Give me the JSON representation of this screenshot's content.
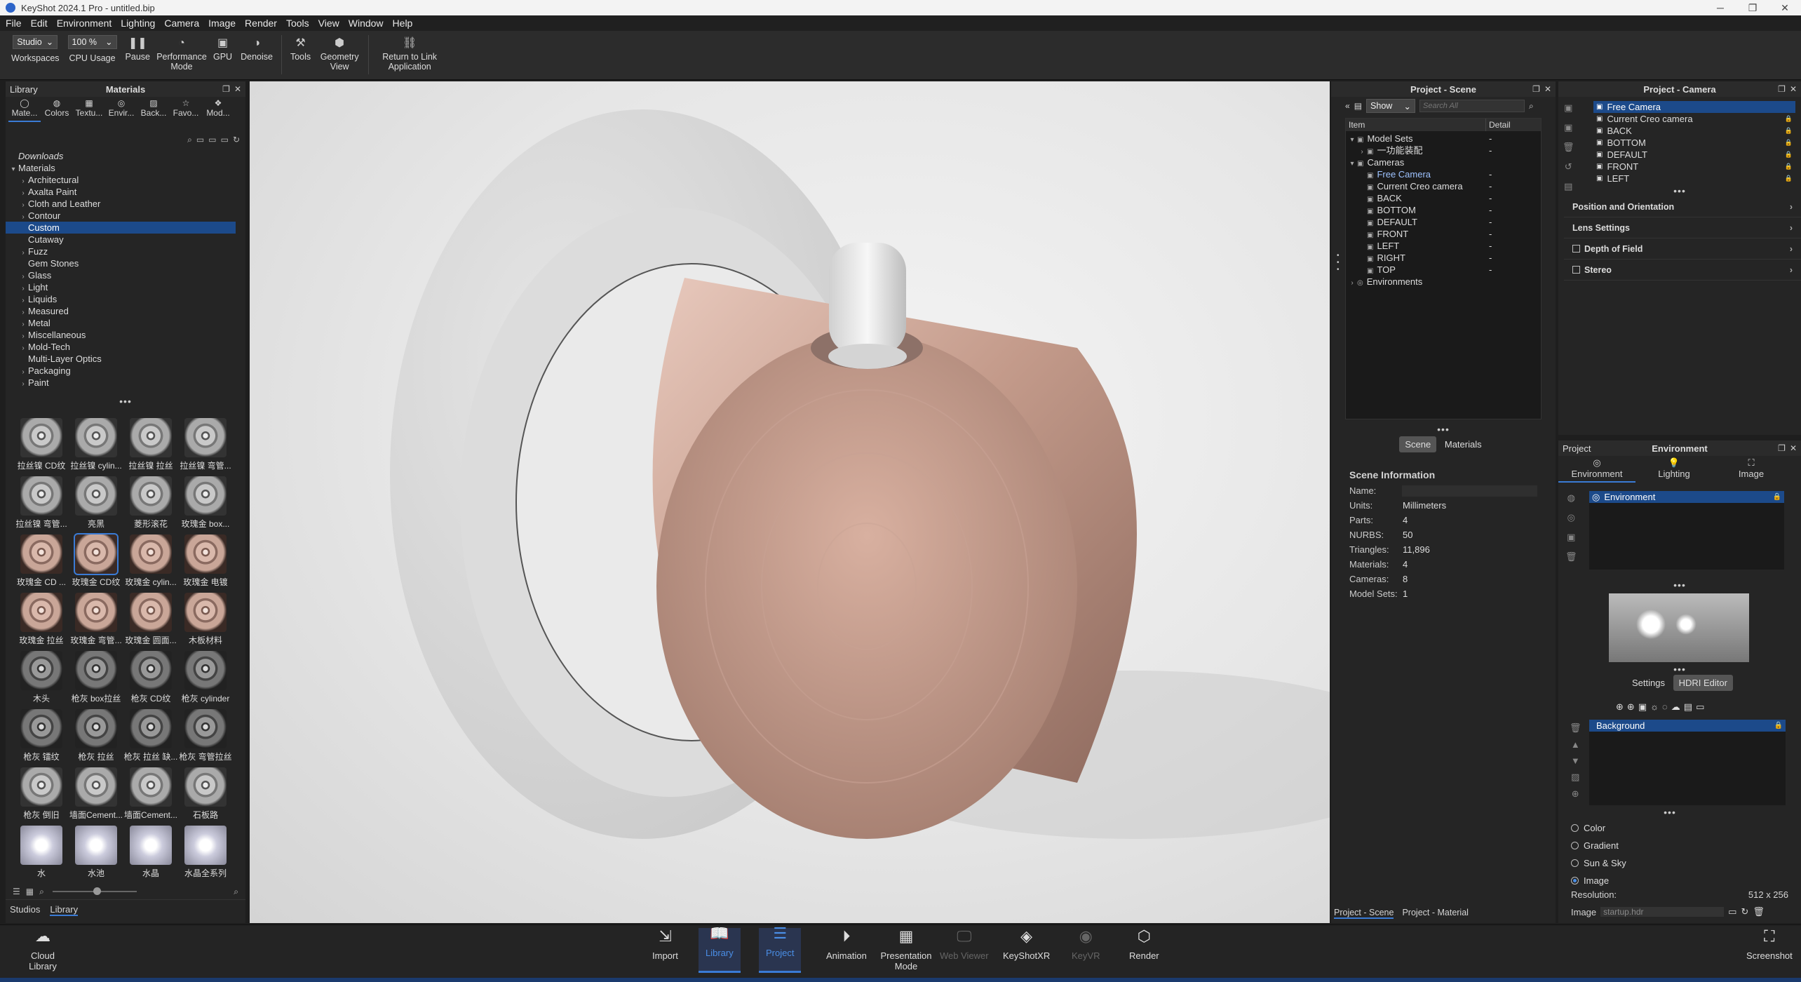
{
  "window": {
    "title": "KeyShot 2024.1 Pro - untitled.bip"
  },
  "menu": [
    "File",
    "Edit",
    "Environment",
    "Lighting",
    "Camera",
    "Image",
    "Render",
    "Tools",
    "View",
    "Window",
    "Help"
  ],
  "toolbar": {
    "workspace_select": "Studio",
    "workspaces_label": "Workspaces",
    "cpu_select": "100 %",
    "cpu_label": "CPU Usage",
    "pause_label": "Pause",
    "perf_label": "Performance Mode",
    "gpu_label": "GPU",
    "denoise_label": "Denoise",
    "tools_label": "Tools",
    "geometry_label": "Geometry View",
    "return_label": "Return to Link Application"
  },
  "library": {
    "panel_title": "Library",
    "header": "Materials",
    "tabs": [
      "Mate...",
      "Colors",
      "Textu...",
      "Envir...",
      "Back...",
      "Favo...",
      "Mod..."
    ],
    "tree": [
      {
        "label": "Downloads",
        "italic": true,
        "indent": 0,
        "arrow": ""
      },
      {
        "label": "Materials",
        "indent": 0,
        "arrow": "v"
      },
      {
        "label": "Architectural",
        "indent": 1,
        "arrow": ">"
      },
      {
        "label": "Axalta Paint",
        "indent": 1,
        "arrow": ">"
      },
      {
        "label": "Cloth and Leather",
        "indent": 1,
        "arrow": ">"
      },
      {
        "label": "Contour",
        "indent": 1,
        "arrow": ">"
      },
      {
        "label": "Custom",
        "indent": 1,
        "arrow": "",
        "selected": true
      },
      {
        "label": "Cutaway",
        "indent": 1,
        "arrow": ""
      },
      {
        "label": "Fuzz",
        "indent": 1,
        "arrow": ">"
      },
      {
        "label": "Gem Stones",
        "indent": 1,
        "arrow": ""
      },
      {
        "label": "Glass",
        "indent": 1,
        "arrow": ">"
      },
      {
        "label": "Light",
        "indent": 1,
        "arrow": ">"
      },
      {
        "label": "Liquids",
        "indent": 1,
        "arrow": ">"
      },
      {
        "label": "Measured",
        "indent": 1,
        "arrow": ">"
      },
      {
        "label": "Metal",
        "indent": 1,
        "arrow": ">"
      },
      {
        "label": "Miscellaneous",
        "indent": 1,
        "arrow": ">"
      },
      {
        "label": "Mold-Tech",
        "indent": 1,
        "arrow": ">"
      },
      {
        "label": "Multi-Layer Optics",
        "indent": 1,
        "arrow": ""
      },
      {
        "label": "Packaging",
        "indent": 1,
        "arrow": ">"
      },
      {
        "label": "Paint",
        "indent": 1,
        "arrow": ">"
      }
    ],
    "thumbs": [
      "拉丝镍 CD纹",
      "拉丝镍 cylin...",
      "拉丝镍 拉丝",
      "拉丝镍 弯管...",
      "拉丝镍 弯管...",
      "亮黑",
      "菱形滚花",
      "玫瑰金 box...",
      "玫瑰金 CD ...",
      "玫瑰金 CD纹",
      "玫瑰金 cylin...",
      "玫瑰金 电镀",
      "玫瑰金 拉丝",
      "玫瑰金 弯管...",
      "玫瑰金 圆面...",
      "木板材料",
      "木头",
      "枪灰 box拉丝",
      "枪灰 CD纹",
      "枪灰 cylinder",
      "枪灰 镭纹",
      "枪灰 拉丝",
      "枪灰 拉丝 缺...",
      "枪灰 弯管拉丝",
      "枪灰 倒旧",
      "墙面Cement...",
      "墙面Cement...",
      "石板路",
      "水",
      "水池",
      "水晶",
      "水晶全系列"
    ],
    "bottom_tabs": [
      "Studios",
      "Library"
    ]
  },
  "scene": {
    "title": "Project - Scene",
    "show_select": "Show",
    "search_placeholder": "Search All",
    "col_item": "Item",
    "col_detail": "Detail",
    "tree": [
      {
        "label": "Model Sets",
        "indent": 0,
        "arrow": "v",
        "detail": "-"
      },
      {
        "label": "一功能装配",
        "indent": 1,
        "arrow": ">",
        "detail": "-"
      },
      {
        "label": "Cameras",
        "indent": 0,
        "arrow": "v",
        "detail": ""
      },
      {
        "label": "Free Camera",
        "indent": 1,
        "arrow": "",
        "detail": "-",
        "blue": true
      },
      {
        "label": "Current Creo camera",
        "indent": 1,
        "arrow": "",
        "detail": "-"
      },
      {
        "label": "BACK",
        "indent": 1,
        "arrow": "",
        "detail": "-"
      },
      {
        "label": "BOTTOM",
        "indent": 1,
        "arrow": "",
        "detail": "-"
      },
      {
        "label": "DEFAULT",
        "indent": 1,
        "arrow": "",
        "detail": "-"
      },
      {
        "label": "FRONT",
        "indent": 1,
        "arrow": "",
        "detail": "-"
      },
      {
        "label": "LEFT",
        "indent": 1,
        "arrow": "",
        "detail": "-"
      },
      {
        "label": "RIGHT",
        "indent": 1,
        "arrow": "",
        "detail": "-"
      },
      {
        "label": "TOP",
        "indent": 1,
        "arrow": "",
        "detail": "-"
      },
      {
        "label": "Environments",
        "indent": 0,
        "arrow": ">",
        "detail": ""
      }
    ],
    "tab_scene": "Scene",
    "tab_materials": "Materials",
    "info_title": "Scene Information",
    "info": [
      [
        "Name:",
        ""
      ],
      [
        "Units:",
        "Millimeters"
      ],
      [
        "Parts:",
        "4"
      ],
      [
        "NURBS:",
        "50"
      ],
      [
        "Triangles:",
        "11,896"
      ],
      [
        "Materials:",
        "4"
      ],
      [
        "Cameras:",
        "8"
      ],
      [
        "Model Sets:",
        "1"
      ]
    ],
    "bottom_tabs": [
      "Project - Scene",
      "Project - Material"
    ]
  },
  "camera": {
    "title": "Project - Camera",
    "list": [
      "Free Camera",
      "Current Creo camera",
      "BACK",
      "BOTTOM",
      "DEFAULT",
      "FRONT",
      "LEFT"
    ],
    "sections": [
      "Position and Orientation",
      "Lens Settings",
      "Depth of Field",
      "Stereo"
    ]
  },
  "environment": {
    "left": "Project",
    "title": "Environment",
    "tabs": [
      "Environment",
      "Lighting",
      "Image"
    ],
    "item": "Environment",
    "btn_settings": "Settings",
    "btn_hdri": "HDRI Editor",
    "background_item": "Background",
    "options": [
      "Color",
      "Gradient",
      "Sun & Sky",
      "Image"
    ],
    "resolution_label": "Resolution:",
    "resolution_value": "512 x 256",
    "image_label": "Image",
    "image_value": "startup.hdr"
  },
  "bottombar": {
    "cloud": "Cloud Library",
    "import": "Import",
    "library": "Library",
    "project": "Project",
    "animation": "Animation",
    "presentation": "Presentation Mode",
    "webviewer": "Web Viewer",
    "keyshotxr": "KeyShotXR",
    "keyvr": "KeyVR",
    "render": "Render",
    "screenshot": "Screenshot"
  }
}
